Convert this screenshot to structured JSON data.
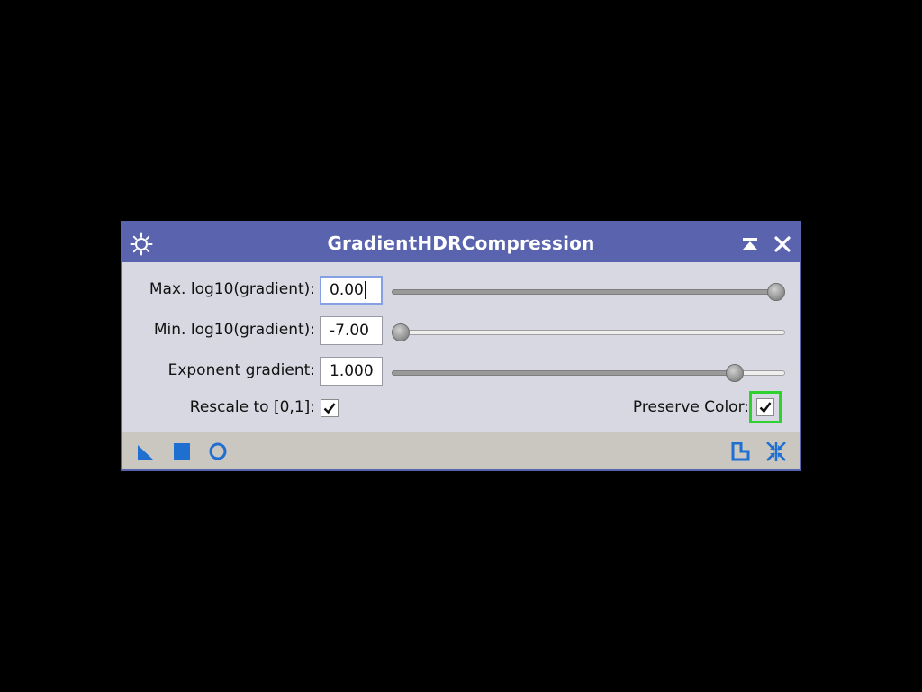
{
  "window": {
    "title": "GradientHDRCompression",
    "icons": {
      "settings": "gear-icon",
      "shade": "collapse-icon",
      "close": "close-icon"
    },
    "accent_color": "#5a64ae"
  },
  "params": {
    "max_gradient": {
      "label": "Max. log10(gradient):",
      "value": "0.00",
      "slider_fraction": 1.0
    },
    "min_gradient": {
      "label": "Min. log10(gradient):",
      "value": "-7.00",
      "slider_fraction": 0.0
    },
    "exponent_gradient": {
      "label": "Exponent gradient:",
      "value": "1.000",
      "slider_fraction": 0.89
    },
    "rescale": {
      "label": "Rescale to [0,1]:",
      "checked": true
    },
    "preserve_color": {
      "label": "Preserve Color:",
      "checked": true,
      "highlight_color": "#2ed12e"
    }
  },
  "bottombar": {
    "left_icons": [
      "new-instance-icon",
      "apply-icon",
      "apply-global-icon"
    ],
    "right_icons": [
      "documentation-icon",
      "reset-icon"
    ],
    "icon_color": "#1f6fd1"
  }
}
